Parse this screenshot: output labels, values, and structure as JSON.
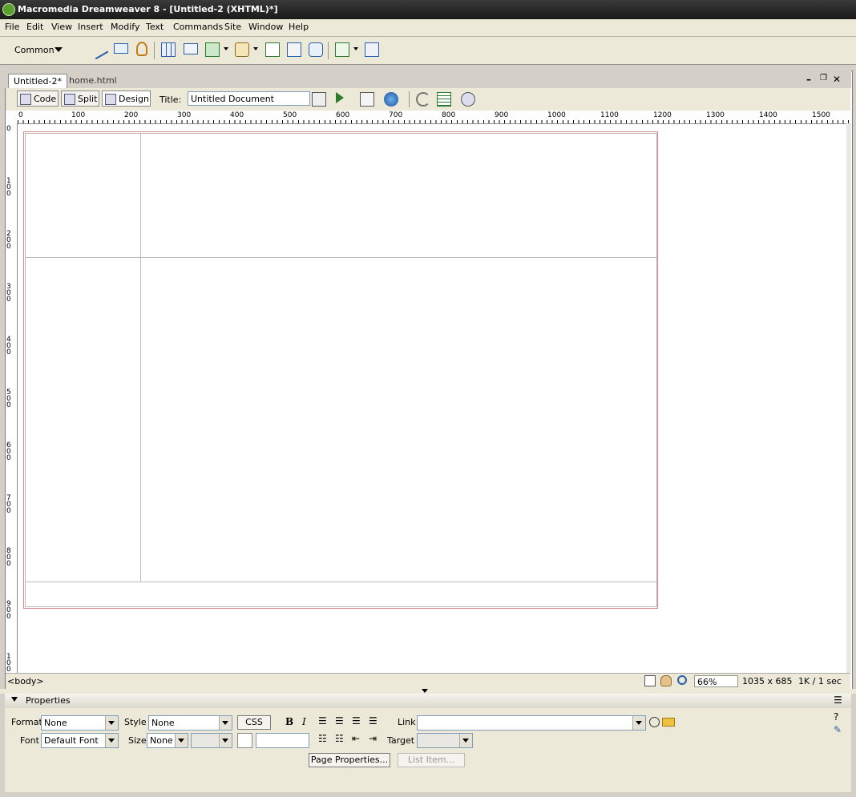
{
  "window": {
    "title": "Macromedia Dreamweaver 8 - [Untitled-2 (XHTML)*]"
  },
  "menu": [
    "File",
    "Edit",
    "View",
    "Insert",
    "Modify",
    "Text",
    "Commands",
    "Site",
    "Window",
    "Help"
  ],
  "insert_bar": {
    "category": "Common",
    "icons": [
      "hyperlink-icon",
      "email-link-icon",
      "named-anchor-icon",
      "table-icon",
      "div-icon",
      "image-icon",
      "media-icon",
      "date-icon",
      "comment-icon",
      "templates-icon",
      "tag-chooser-icon"
    ]
  },
  "document": {
    "tabs": [
      {
        "label": "Untitled-2*",
        "active": true
      },
      {
        "label": "home.html",
        "active": false
      }
    ],
    "views": [
      {
        "label": "Code"
      },
      {
        "label": "Split"
      },
      {
        "label": "Design",
        "active": true
      }
    ],
    "title_label": "Title:",
    "title_value": "Untitled Document"
  },
  "ruler": {
    "h_labels": [
      "0",
      "100",
      "200",
      "300",
      "400",
      "500",
      "600",
      "700",
      "800",
      "900",
      "1000",
      "1100",
      "1200",
      "1300",
      "1400",
      "1500"
    ],
    "v_labels": [
      "0",
      "100",
      "200",
      "300",
      "400",
      "500",
      "600",
      "700",
      "800",
      "900",
      "100"
    ]
  },
  "status": {
    "tag": "<body>",
    "zoom": "66%",
    "size": "1035 x 685",
    "download": "1K / 1 sec"
  },
  "properties": {
    "title": "Properties",
    "format_label": "Format",
    "format_value": "None",
    "style_label": "Style",
    "style_value": "None",
    "css_label": "CSS",
    "bold": "B",
    "italic": "I",
    "link_label": "Link",
    "font_label": "Font",
    "font_value": "Default Font",
    "size_label": "Size",
    "size_value": "None",
    "target_label": "Target",
    "page_properties": "Page Properties...",
    "list_item": "List Item..."
  },
  "colors": {
    "table_border": "#d98b8b",
    "title_bar": "#1a1a1a",
    "chrome": "#ece9d8"
  }
}
